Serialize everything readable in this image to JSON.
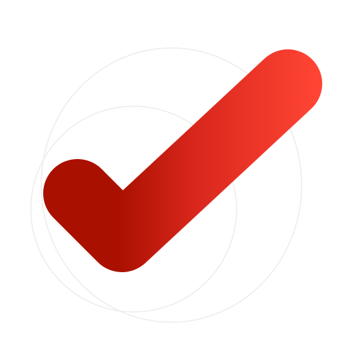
{
  "icon": {
    "name": "checkmark-icon",
    "colors": {
      "gradient_dark": "#a91000",
      "gradient_mid": "#d8261c",
      "gradient_light": "#ff4433",
      "background": "#ffffff",
      "ring": "#ececec"
    }
  }
}
